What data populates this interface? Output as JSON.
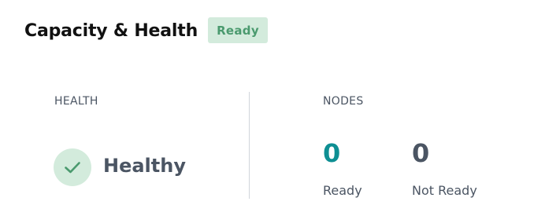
{
  "header": {
    "title": "Capacity & Health",
    "status_badge": "Ready"
  },
  "health": {
    "label": "HEALTH",
    "status": "Healthy",
    "icon": "check-icon"
  },
  "nodes": {
    "label": "NODES",
    "ready": {
      "count": "0",
      "caption": "Ready"
    },
    "not_ready": {
      "count": "0",
      "caption": "Not Ready"
    }
  },
  "colors": {
    "badge_bg": "#d3ebdc",
    "badge_text": "#4a9a6e",
    "ready_count": "#0e8f93",
    "muted_text": "#4b5563"
  }
}
